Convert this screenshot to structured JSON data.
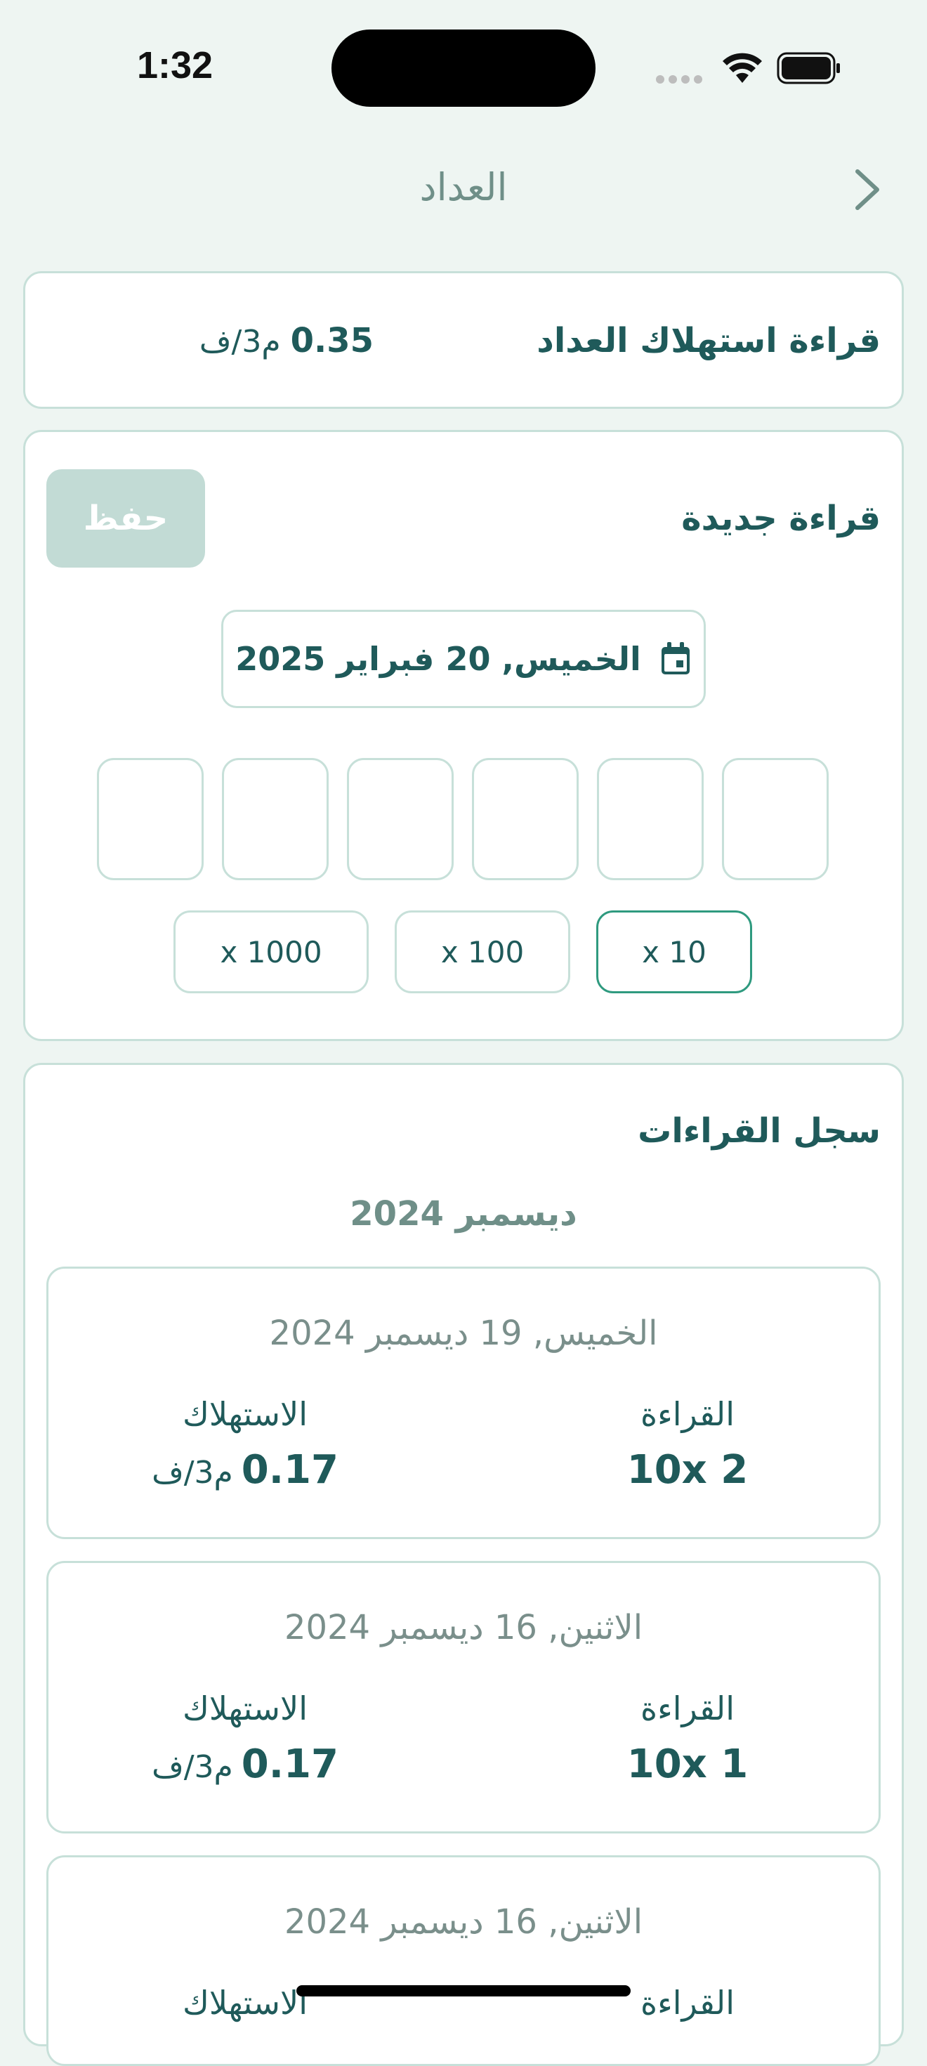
{
  "status_bar": {
    "time": "1:32"
  },
  "nav": {
    "title": "العداد"
  },
  "consumption_card": {
    "title": "قراءة استهلاك العداد",
    "value": "0.35",
    "unit": "م3/ف"
  },
  "new_reading": {
    "title": "قراءة جديدة",
    "save_label": "حفظ",
    "date": "الخميس, 20 فبراير 2025",
    "multipliers": [
      {
        "label": "x 10",
        "selected": true
      },
      {
        "label": "x 100",
        "selected": false
      },
      {
        "label": "x 1000",
        "selected": false
      }
    ]
  },
  "history": {
    "title": "سجل القراءات",
    "month": "ديسمبر 2024",
    "reading_label": "القراءة",
    "consumption_label": "الاستهلاك",
    "entries": [
      {
        "date": "الخميس, 19 ديسمبر 2024",
        "reading": "10x 2",
        "consumption_value": "0.17",
        "consumption_unit": "م3/ف"
      },
      {
        "date": "الاثنين, 16 ديسمبر 2024",
        "reading": "10x 1",
        "consumption_value": "0.17",
        "consumption_unit": "م3/ف"
      },
      {
        "date": "الاثنين, 16 ديسمبر 2024",
        "reading": "",
        "consumption_value": "",
        "consumption_unit": ""
      }
    ]
  }
}
